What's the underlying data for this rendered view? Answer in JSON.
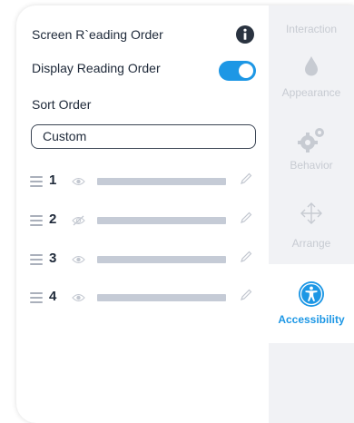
{
  "settings": {
    "screen_reading_order_label": "Screen R`eading Order",
    "display_reading_order_label": "Display Reading Order",
    "display_reading_order_on": true,
    "sort_order_label": "Sort Order",
    "sort_order_value": "Custom"
  },
  "items": [
    {
      "number": "1",
      "visible": true
    },
    {
      "number": "2",
      "visible": false
    },
    {
      "number": "3",
      "visible": true
    },
    {
      "number": "4",
      "visible": true
    }
  ],
  "rail": {
    "interaction_label": "Interaction",
    "appearance_label": "Appearance",
    "behavior_label": "Behavior",
    "arrange_label": "Arrange",
    "accessibility_label": "Accessibility"
  },
  "colors": {
    "accent": "#1d97e5",
    "text": "#202b3b",
    "muted": "#c7cbd2",
    "rail_bg": "#f1f2f5",
    "bar": "#c5cbd6"
  },
  "icons": [
    "info-icon",
    "drag-handle-icon",
    "eye-icon",
    "eye-off-icon",
    "pencil-icon",
    "drop-icon",
    "gears-icon",
    "move-arrows-icon",
    "accessibility-icon"
  ]
}
